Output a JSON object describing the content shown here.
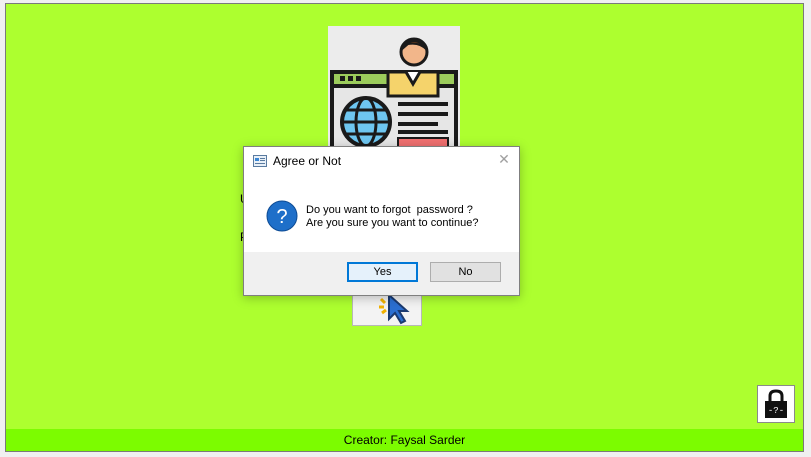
{
  "background_colors": {
    "form": "#adff2f",
    "status_bar": "#7cfc00"
  },
  "form": {
    "partial_labels": [
      "U",
      "P"
    ]
  },
  "status_bar": {
    "text": "Creator: Faysal Sarder"
  },
  "dialog": {
    "title": "Agree or Not",
    "close_icon": "close-icon",
    "message_line1": "Do you want to forgot  password ?",
    "message_line2": "Are you sure you want to continue?",
    "buttons": {
      "yes": "Yes",
      "no": "No"
    }
  },
  "icons": [
    "user-web-icon",
    "cursor-icon",
    "lock-help-icon",
    "question-icon",
    "app-icon"
  ]
}
